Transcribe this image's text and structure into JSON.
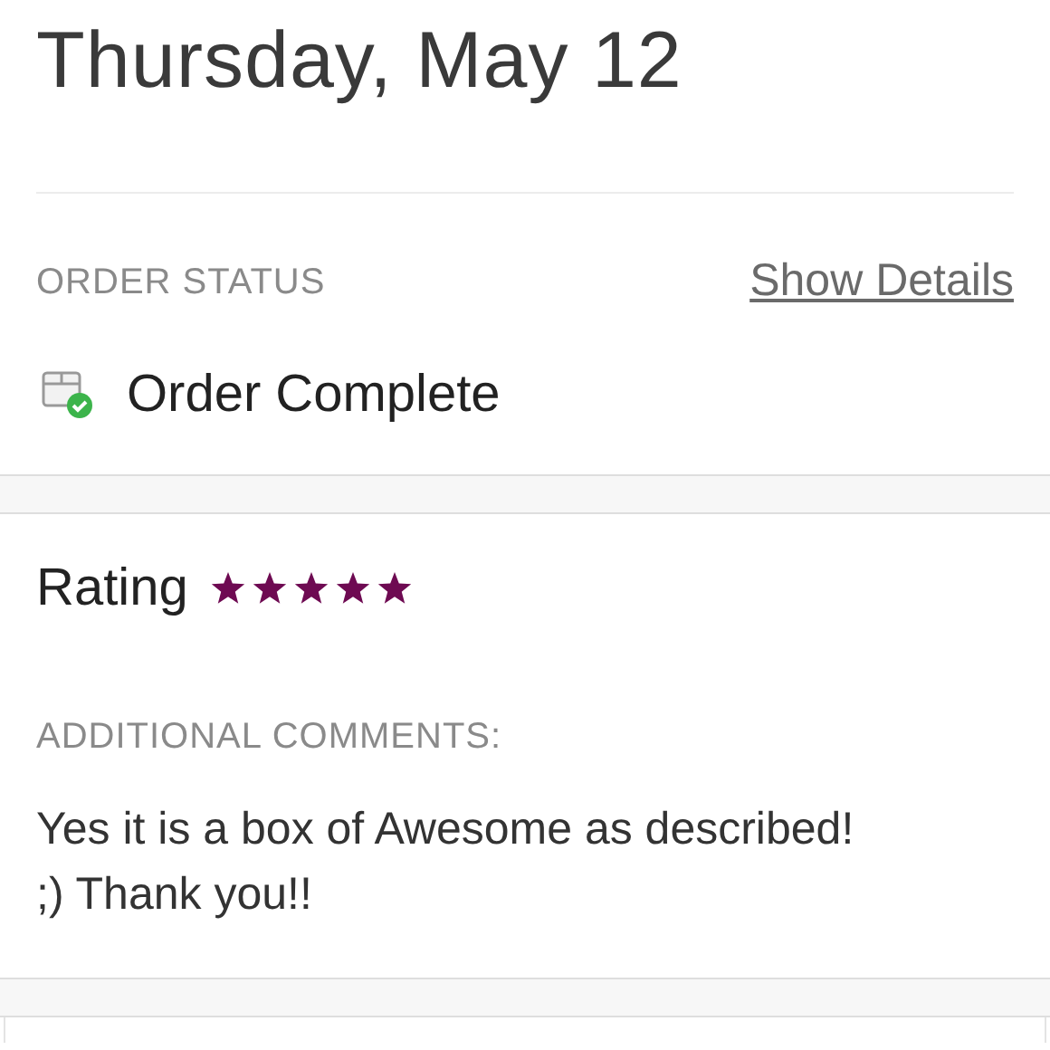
{
  "date": "Thursday, May 12",
  "order_status": {
    "label": "ORDER STATUS",
    "link": "Show Details",
    "status": "Order Complete"
  },
  "rating": {
    "label": "Rating",
    "stars": 5
  },
  "comments": {
    "label": "ADDITIONAL COMMENTS:",
    "lines": [
      "Yes it is a box of Awesome as described!",
      ";) Thank you!!"
    ]
  }
}
